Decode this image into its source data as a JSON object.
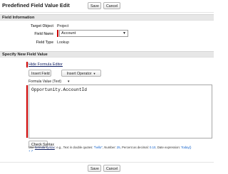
{
  "page": {
    "title": "Predefined Field Value Edit"
  },
  "buttons": {
    "save_label": "Save",
    "cancel_label": "Cancel"
  },
  "field_information": {
    "section_title": "Field Information",
    "target_object_label": "Target Object",
    "target_object_value": "Project",
    "field_name_label": "Field Name",
    "field_name_value": "Account",
    "field_type_label": "Field Type",
    "field_type_value": "Lookup"
  },
  "new_field_value": {
    "section_title": "Specify New Field Value",
    "hide_editor_link": "Hide Formula Editor",
    "insert_field_label": "Insert Field",
    "insert_operator_label": "Insert Operator",
    "formula_label": "Formula Value (Text)",
    "formula_text": "Opportunity.AccountId",
    "check_syntax_label": "Check Syntax",
    "help": {
      "prefix": "Use",
      "link_text": "formula syntax",
      "middle": ": e.g., Text in double quotes: ",
      "example_text": "\"hello\"",
      "number_label": ", Number: ",
      "example_number": "25",
      "percent_label": ", Percent as decimal: ",
      "example_percent": "0.10",
      "date_label": ", Date expression: ",
      "example_date_start": "Today()",
      "example_date_end": "+ 7"
    }
  },
  "colors": {
    "required_marker": "#cc0000",
    "section_header_bg": "#e7e7e7",
    "link": "#0d1d61",
    "example_value": "#0d5ec9"
  }
}
